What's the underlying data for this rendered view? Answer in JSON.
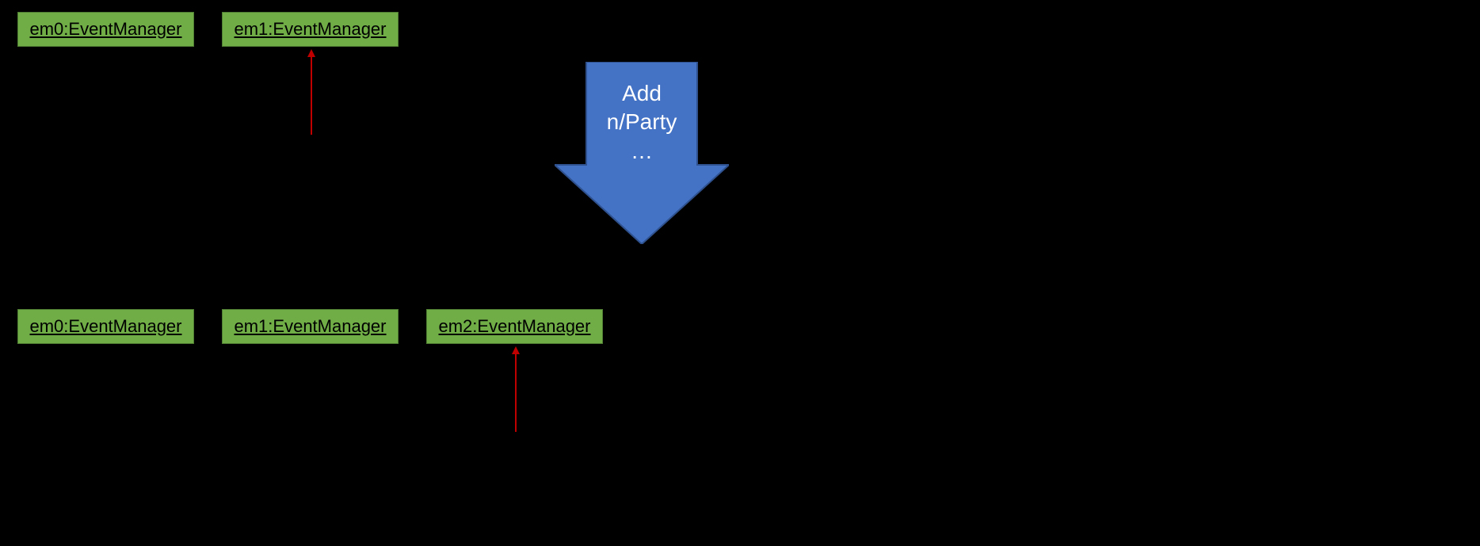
{
  "topRow": {
    "box1": "em0:EventManager",
    "box2": "em1:EventManager"
  },
  "bottomRow": {
    "box1": "em0:EventManager",
    "box2": "em1:EventManager",
    "box3": "em2:EventManager"
  },
  "arrowLabel": {
    "line1": "Add",
    "line2": "n/Party",
    "line3": "…"
  }
}
